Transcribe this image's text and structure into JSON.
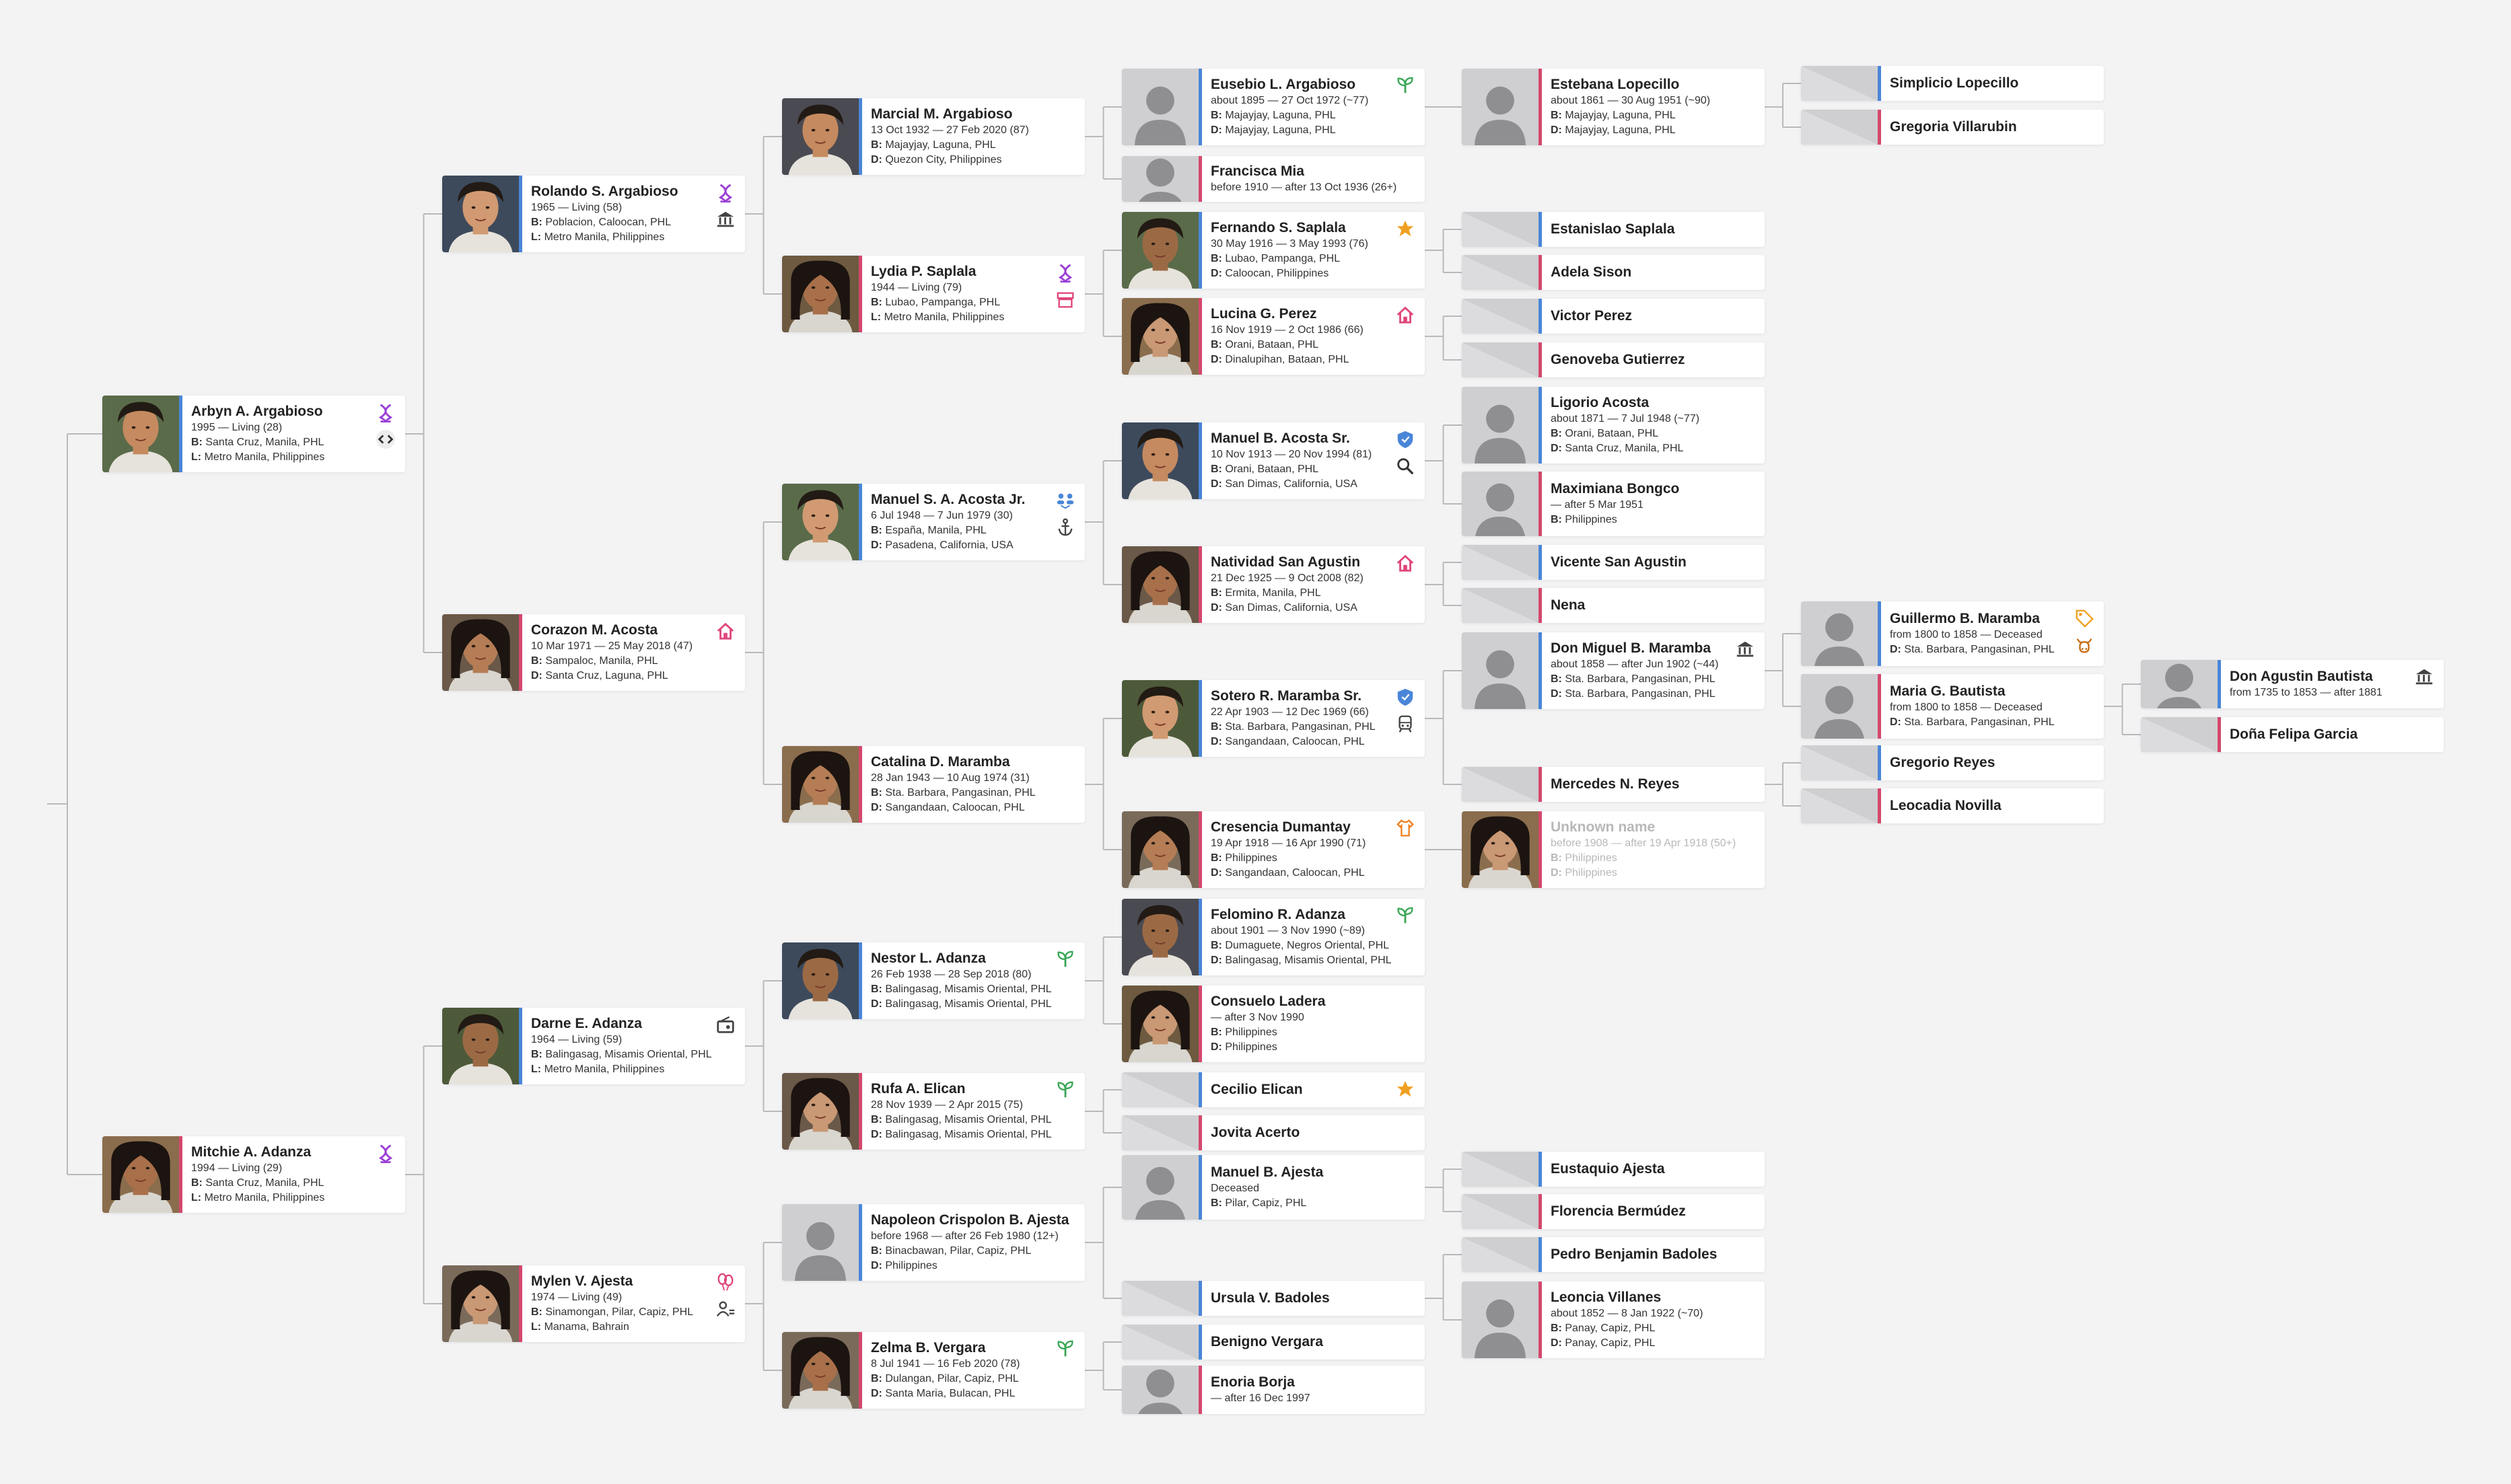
{
  "people": {
    "p1": {
      "name": "Arbyn A. Argabioso",
      "life": "1995 — Living (28)",
      "birth": "Santa Cruz, Manila, PHL",
      "living": "Metro Manila, Philippines",
      "icons": [
        "dna-icon",
        "code-icon"
      ]
    },
    "p2": {
      "name": "Mitchie A. Adanza",
      "life": "1994 — Living (29)",
      "birth": "Santa Cruz, Manila, PHL",
      "living": "Metro Manila, Philippines",
      "icons": [
        "dna-icon"
      ]
    },
    "r1": {
      "name": "Rolando S. Argabioso",
      "life": "1965 — Living (58)",
      "birth": "Poblacion, Caloocan, PHL",
      "living": "Metro Manila, Philippines",
      "icons": [
        "dna-icon",
        "bank-icon"
      ]
    },
    "r2": {
      "name": "Corazon M. Acosta",
      "life": "10 Mar 1971 — 25 May 2018 (47)",
      "birth": "Sampaloc, Manila, PHL",
      "death": "Santa Cruz, Laguna, PHL",
      "icons": [
        "home-icon"
      ]
    },
    "r3": {
      "name": "Darne E. Adanza",
      "life": "1964 — Living (59)",
      "birth": "Balingasag, Misamis Oriental, PHL",
      "living": "Metro Manila, Philippines",
      "icons": [
        "radio-icon"
      ]
    },
    "r4": {
      "name": "Mylen V. Ajesta",
      "life": "1974 — Living (49)",
      "birth": "Sinamongan, Pilar, Capiz, PHL",
      "living": "Manama, Bahrain",
      "icons": [
        "balloon-icon",
        "person-icon"
      ]
    },
    "g1": {
      "name": "Marcial M. Argabioso",
      "life": "13 Oct 1932 — 27 Feb 2020 (87)",
      "birth": "Majayjay, Laguna, PHL",
      "death": "Quezon City, Philippines",
      "icons": []
    },
    "g2": {
      "name": "Lydia P. Saplala",
      "life": "1944 — Living (79)",
      "birth": "Lubao, Pampanga, PHL",
      "living": "Metro Manila, Philippines",
      "icons": [
        "dna-icon",
        "store-icon"
      ]
    },
    "g3": {
      "name": "Manuel S. A. Acosta Jr.",
      "life": "6 Jul 1948 — 7 Jun 1979 (30)",
      "birth": "España, Manila, PHL",
      "death": "Pasadena, California, USA",
      "icons": [
        "people-icon",
        "anchor-icon"
      ]
    },
    "g4": {
      "name": "Catalina D. Maramba",
      "life": "28 Jan 1943 — 10 Aug 1974 (31)",
      "birth": "Sta. Barbara, Pangasinan, PHL",
      "death": "Sangandaan, Caloocan, PHL",
      "icons": []
    },
    "g5": {
      "name": "Nestor L. Adanza",
      "life": "26 Feb 1938 — 28 Sep 2018 (80)",
      "birth": "Balingasag, Misamis Oriental, PHL",
      "death": "Balingasag, Misamis Oriental, PHL",
      "icons": [
        "sprout-icon"
      ]
    },
    "g6": {
      "name": "Rufa A. Elican",
      "life": "28 Nov 1939 — 2 Apr 2015 (75)",
      "birth": "Balingasag, Misamis Oriental, PHL",
      "death": "Balingasag, Misamis Oriental, PHL",
      "icons": [
        "sprout-icon"
      ]
    },
    "g7": {
      "name": "Napoleon Crispolon B. Ajesta",
      "life": "before 1968 — after 26 Feb 1980 (12+)",
      "birth": "Binacbawan, Pilar, Capiz, PHL",
      "death": "Philippines",
      "icons": []
    },
    "g8": {
      "name": "Zelma B. Vergara",
      "life": "8 Jul 1941 — 16 Feb 2020 (78)",
      "birth": "Dulangan, Pilar, Capiz, PHL",
      "death": "Santa Maria, Bulacan, PHL",
      "icons": [
        "sprout-icon"
      ]
    },
    "h1": {
      "name": "Eusebio L. Argabioso",
      "life": "about 1895 — 27 Oct 1972 (~77)",
      "birth": "Majayjay, Laguna, PHL",
      "death": "Majayjay, Laguna, PHL",
      "icons": [
        "sprout-icon"
      ]
    },
    "h2": {
      "name": "Francisca Mia",
      "life": "before 1910 — after 13 Oct 1936 (26+)",
      "icons": []
    },
    "h3": {
      "name": "Fernando S. Saplala",
      "life": "30 May 1916 — 3 May 1993 (76)",
      "birth": "Lubao, Pampanga, PHL",
      "death": "Caloocan, Philippines",
      "icons": [
        "star-icon"
      ]
    },
    "h4": {
      "name": "Lucina G. Perez",
      "life": "16 Nov 1919 — 2 Oct 1986 (66)",
      "birth": "Orani, Bataan, PHL",
      "death": "Dinalupihan, Bataan, PHL",
      "icons": [
        "home-icon"
      ]
    },
    "h5": {
      "name": "Manuel B. Acosta Sr.",
      "life": "10 Nov 1913 — 20 Nov 1994 (81)",
      "birth": "Orani, Bataan, PHL",
      "death": "San Dimas, California, USA",
      "icons": [
        "shield-icon",
        "search-icon"
      ]
    },
    "h6": {
      "name": "Natividad San Agustin",
      "life": "21 Dec 1925 — 9 Oct 2008 (82)",
      "birth": "Ermita, Manila, PHL",
      "death": "San Dimas, California, USA",
      "icons": [
        "home-icon"
      ]
    },
    "h7": {
      "name": "Sotero R. Maramba Sr.",
      "life": "22 Apr 1903 — 12 Dec 1969 (66)",
      "birth": "Sta. Barbara, Pangasinan, PHL",
      "death": "Sangandaan, Caloocan, PHL",
      "icons": [
        "shield-icon",
        "train-icon"
      ]
    },
    "h8": {
      "name": "Cresencia Dumantay",
      "life": "19 Apr 1918 — 16 Apr 1990 (71)",
      "birth": "Philippines",
      "death": "Sangandaan, Caloocan, PHL",
      "icons": [
        "shirt-icon"
      ]
    },
    "h9": {
      "name": "Felomino R. Adanza",
      "life": "about 1901 — 3 Nov 1990 (~89)",
      "birth": "Dumaguete, Negros Oriental, PHL",
      "death": "Balingasag, Misamis Oriental, PHL",
      "icons": [
        "sprout-icon"
      ]
    },
    "h10": {
      "name": "Consuelo Ladera",
      "life": "— after 3 Nov 1990",
      "birth": "Philippines",
      "death": "Philippines",
      "icons": []
    },
    "h11": {
      "name": "Cecilio Elican",
      "icons": [
        "star-icon"
      ]
    },
    "h12": {
      "name": "Jovita Acerto",
      "icons": []
    },
    "h13": {
      "name": "Manuel B. Ajesta",
      "life": "Deceased",
      "birth": "Pilar, Capiz, PHL",
      "icons": []
    },
    "h14": {
      "name": "Ursula V. Badoles",
      "icons": []
    },
    "h15": {
      "name": "Benigno Vergara",
      "icons": []
    },
    "h16": {
      "name": "Enoria Borja",
      "life": "— after 16 Dec 1997",
      "icons": []
    },
    "i1": {
      "name": "Estebana Lopecillo",
      "life": "about 1861 — 30 Aug 1951 (~90)",
      "birth": "Majayjay, Laguna, PHL",
      "death": "Majayjay, Laguna, PHL"
    },
    "i2": {
      "name": "Estanislao Saplala"
    },
    "i3": {
      "name": "Adela Sison"
    },
    "i4": {
      "name": "Victor Perez"
    },
    "i5": {
      "name": "Genoveba Gutierrez"
    },
    "i6": {
      "name": "Ligorio Acosta",
      "life": "about 1871 — 7 Jul 1948 (~77)",
      "birth": "Orani, Bataan, PHL",
      "death": "Santa Cruz, Manila, PHL"
    },
    "i7": {
      "name": "Maximiana Bongco",
      "life": "— after 5 Mar 1951",
      "birth": "Philippines"
    },
    "i8": {
      "name": "Vicente San Agustin"
    },
    "i9": {
      "name": "Nena"
    },
    "i10": {
      "name": "Don Miguel B. Maramba",
      "life": "about 1858 — after Jun 1902 (~44)",
      "birth": "Sta. Barbara, Pangasinan, PHL",
      "death": "Sta. Barbara, Pangasinan, PHL",
      "icons": [
        "bank-icon"
      ]
    },
    "i11": {
      "name": "Mercedes N. Reyes"
    },
    "i12": {
      "name": "Unknown name",
      "life": "before 1908 — after 19 Apr 1918 (50+)",
      "birth": "Philippines",
      "death": "Philippines"
    },
    "i13": {
      "name": "Eustaquio Ajesta"
    },
    "i14": {
      "name": "Florencia Bermúdez"
    },
    "i15": {
      "name": "Pedro Benjamin Badoles"
    },
    "i16": {
      "name": "Leoncia Villanes",
      "life": "about 1852 — 8 Jan 1922 (~70)",
      "birth": "Panay, Capiz, PHL",
      "death": "Panay, Capiz, PHL"
    },
    "j1": {
      "name": "Simplicio Lopecillo"
    },
    "j2": {
      "name": "Gregoria Villarubin"
    },
    "j3": {
      "name": "Guillermo B. Maramba",
      "life": "from 1800 to 1858 — Deceased",
      "death": "Sta. Barbara, Pangasinan, PHL",
      "icons": [
        "tag-icon",
        "cow-icon"
      ]
    },
    "j4": {
      "name": "Maria G. Bautista",
      "life": "from 1800 to 1858 — Deceased",
      "death": "Sta. Barbara, Pangasinan, PHL"
    },
    "j5": {
      "name": "Gregorio Reyes"
    },
    "j6": {
      "name": "Leocadia Novilla"
    },
    "k1": {
      "name": "Don Agustin Bautista",
      "life": "from 1735 to 1853 — after 1881",
      "icons": [
        "bank-icon"
      ]
    },
    "k2": {
      "name": "Doña Felipa Garcia"
    }
  },
  "labels": {
    "born": "B:",
    "died": "D:",
    "living": "L:"
  },
  "colors": {
    "male": "#4a86d8",
    "female": "#d4486d",
    "line": "#b9b9bc",
    "background": "#f3f3f4"
  }
}
